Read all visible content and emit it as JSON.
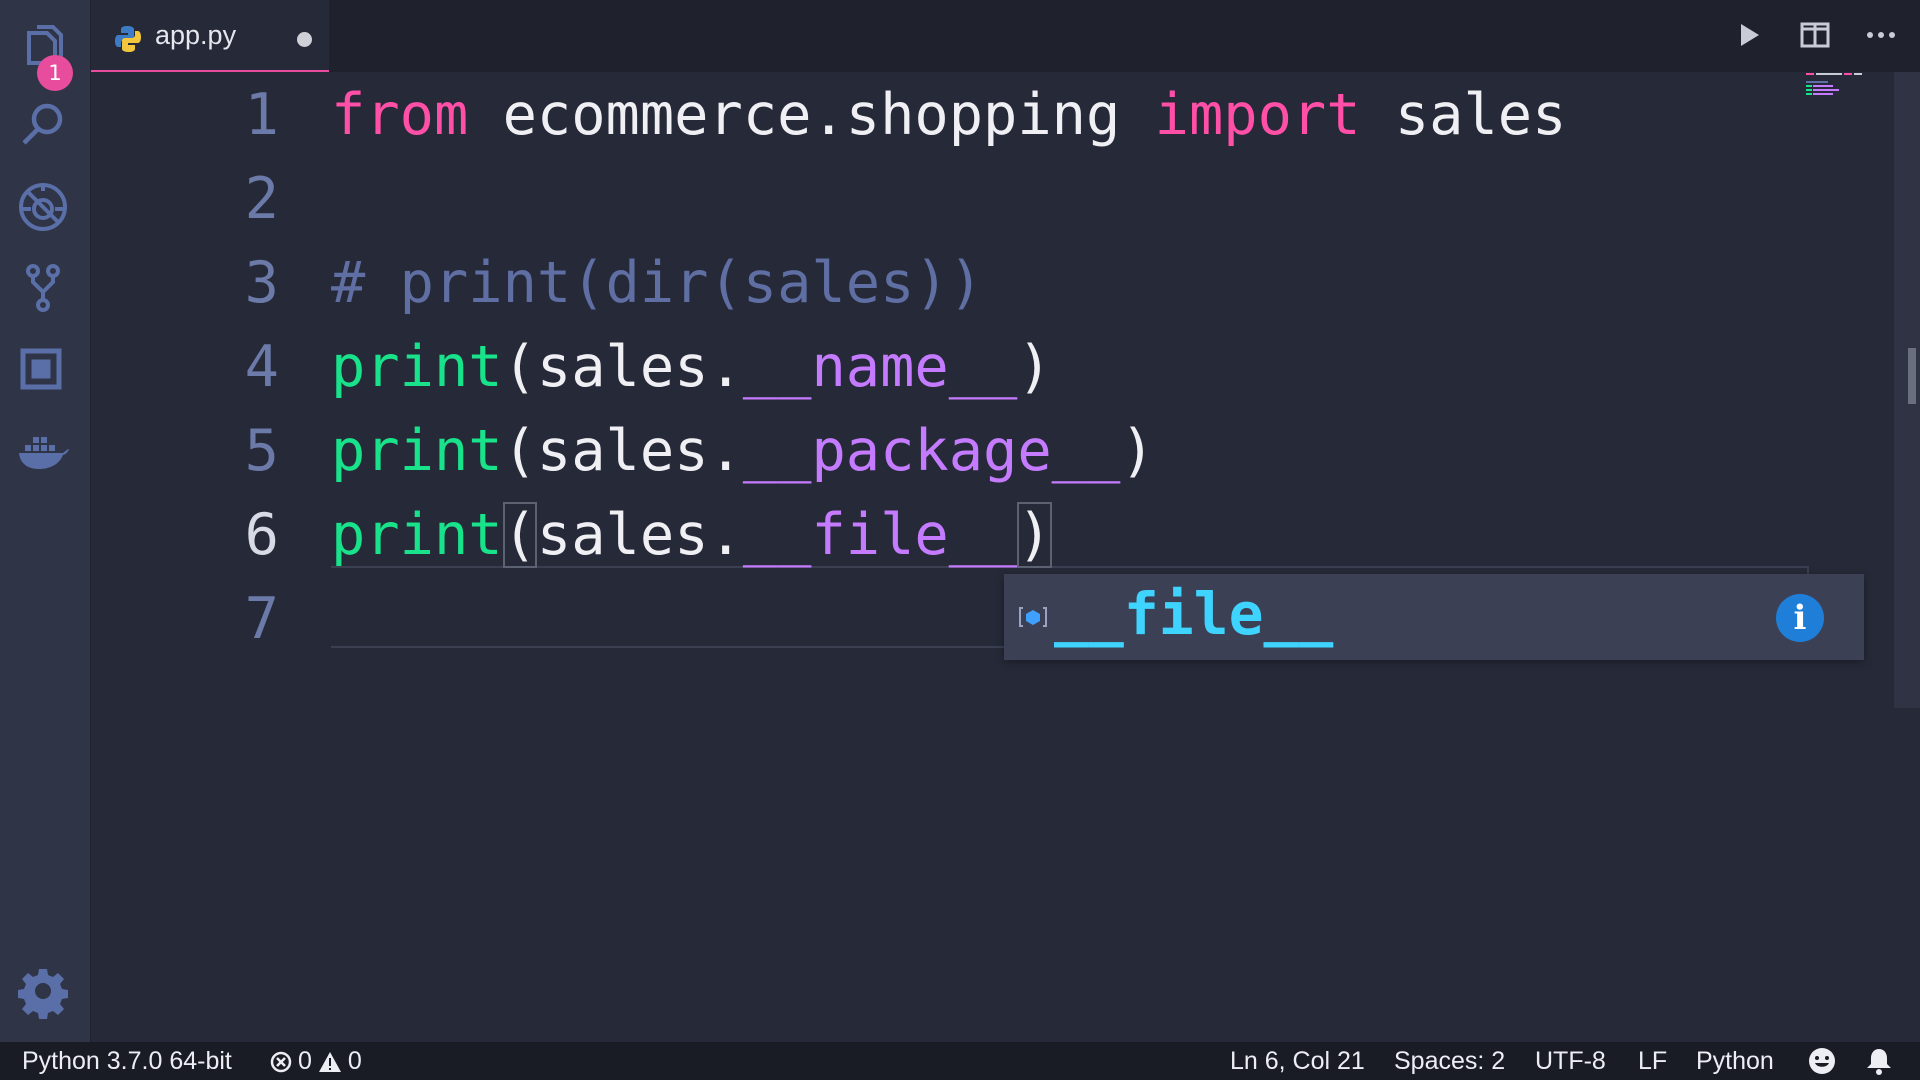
{
  "tab": {
    "filename": "app.py",
    "dirty": true
  },
  "activity": {
    "badge_count": "1"
  },
  "editor": {
    "lines": [
      {
        "num": "1",
        "tokens": [
          "from",
          " ecommerce.shopping ",
          "import",
          " sales"
        ]
      },
      {
        "num": "2"
      },
      {
        "num": "3",
        "comment": "# print(dir(sales))"
      },
      {
        "num": "4",
        "fn": "print",
        "open": "(",
        "obj": "sales.",
        "attr": "__name__",
        "close": ")"
      },
      {
        "num": "5",
        "fn": "print",
        "open": "(",
        "obj": "sales.",
        "attr": "__package__",
        "close": ")"
      },
      {
        "num": "6",
        "fn": "print",
        "open": "(",
        "obj": "sales.",
        "attr": "__file__",
        "close": ")"
      },
      {
        "num": "7"
      }
    ]
  },
  "suggest": {
    "item": "__file__",
    "info": "i"
  },
  "status": {
    "interpreter": "Python 3.7.0 64-bit",
    "errors": "0",
    "warnings": "0",
    "position": "Ln 6, Col 21",
    "spaces": "Spaces: 2",
    "encoding": "UTF-8",
    "eol": "LF",
    "language": "Python"
  },
  "colors": {
    "keyword": "#ff4fa6",
    "function": "#18e28a",
    "dunder": "#c57bff",
    "comment": "#5f6ea3",
    "suggest_text": "#3fd4ff",
    "tab_accent": "#e84c9c"
  },
  "icons": [
    "explorer-icon",
    "search-icon",
    "debug-icon",
    "source-control-icon",
    "extensions-icon",
    "docker-icon",
    "gear-icon",
    "run-icon",
    "split-editor-icon",
    "more-actions-icon",
    "python-file-icon",
    "error-icon",
    "warning-icon",
    "feedback-smiley-icon",
    "bell-icon"
  ]
}
